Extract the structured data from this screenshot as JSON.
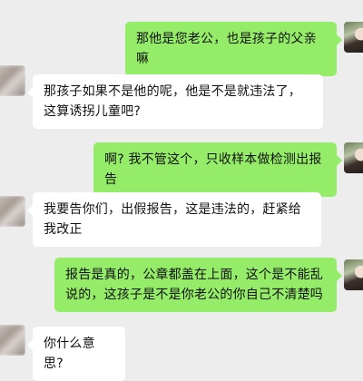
{
  "messages": [
    {
      "side": "right",
      "text": "那他是您老公，也是孩子的父亲嘛",
      "avatar": "sender-photo"
    },
    {
      "side": "left",
      "text": "那孩子如果不是他的呢，他是不是就违法了，这算诱拐儿童吧?",
      "avatar": "blurred-avatar"
    },
    {
      "side": "right",
      "text": "啊? 我不管这个，只收样本做检测出报告",
      "avatar": "sender-photo"
    },
    {
      "side": "left",
      "text": "我要告你们，出假报告，这是违法的，赶紧给我改正",
      "avatar": "blurred-avatar"
    },
    {
      "side": "right",
      "text": "报告是真的，公章都盖在上面，这个是不能乱说的，这孩子是不是你老公的你自己不清楚吗",
      "avatar": "sender-photo"
    },
    {
      "side": "left",
      "text": "你什么意思?",
      "avatar": "blurred-avatar"
    }
  ],
  "colors": {
    "background": "#ededed",
    "incoming_bubble": "#ffffff",
    "outgoing_bubble": "#95ec69"
  }
}
